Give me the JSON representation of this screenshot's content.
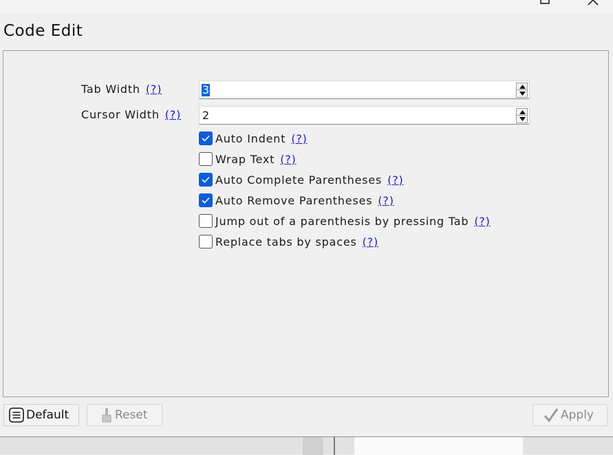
{
  "page": {
    "title": "Code Edit"
  },
  "tab_width": {
    "label": "Tab Width",
    "help": "(?)",
    "value": "3"
  },
  "cursor_width": {
    "label": "Cursor Width",
    "help": "(?)",
    "value": "2"
  },
  "options": [
    {
      "label": "Auto Indent",
      "help": "(?)",
      "checked": true
    },
    {
      "label": "Wrap Text",
      "help": "(?)",
      "checked": false
    },
    {
      "label": "Auto Complete Parentheses",
      "help": "(?)",
      "checked": true
    },
    {
      "label": "Auto Remove Parentheses",
      "help": "(?)",
      "checked": true
    },
    {
      "label": "Jump out of a parenthesis by pressing Tab",
      "help": "(?)",
      "checked": false
    },
    {
      "label": "Replace tabs by spaces",
      "help": "(?)",
      "checked": false
    }
  ],
  "buttons": {
    "default": "Default",
    "reset": "Reset",
    "apply": "Apply"
  },
  "colors": {
    "accent": "#0b5cd7",
    "link": "#1a1ad0",
    "disabled_text": "#8a8a8a"
  },
  "icons": {
    "maximize": "maximize-icon",
    "close": "close-icon",
    "default": "list-icon",
    "reset": "brush-icon",
    "apply": "checkmark-icon",
    "spin_up": "arrow-up-icon",
    "spin_down": "arrow-down-icon"
  }
}
